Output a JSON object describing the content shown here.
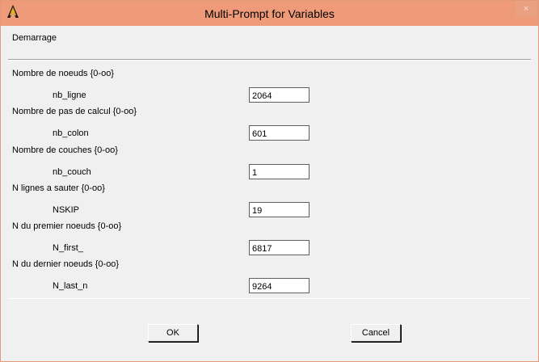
{
  "window": {
    "title": "Multi-Prompt for Variables",
    "close_symbol": "×",
    "app_icon": "ansys-logo-icon",
    "titlebar_color": "#ef9a78"
  },
  "header": {
    "label": "Demarrage"
  },
  "fields": [
    {
      "group_label": "Nombre de noeuds {0-oo}",
      "var_name": "nb_ligne",
      "value": "2064"
    },
    {
      "group_label": "Nombre de pas de calcul {0-oo}",
      "var_name": "nb_colon",
      "value": "601"
    },
    {
      "group_label": "Nombre de couches {0-oo}",
      "var_name": "nb_couch",
      "value": "1"
    },
    {
      "group_label": "N lignes a sauter {0-oo}",
      "var_name": "NSKIP",
      "value": "19"
    },
    {
      "group_label": "N du premier noeuds {0-oo}",
      "var_name": "N_first_",
      "value": "6817"
    },
    {
      "group_label": "N du dernier noeuds {0-oo}",
      "var_name": "N_last_n",
      "value": "9264"
    }
  ],
  "buttons": {
    "ok": "OK",
    "cancel": "Cancel"
  }
}
